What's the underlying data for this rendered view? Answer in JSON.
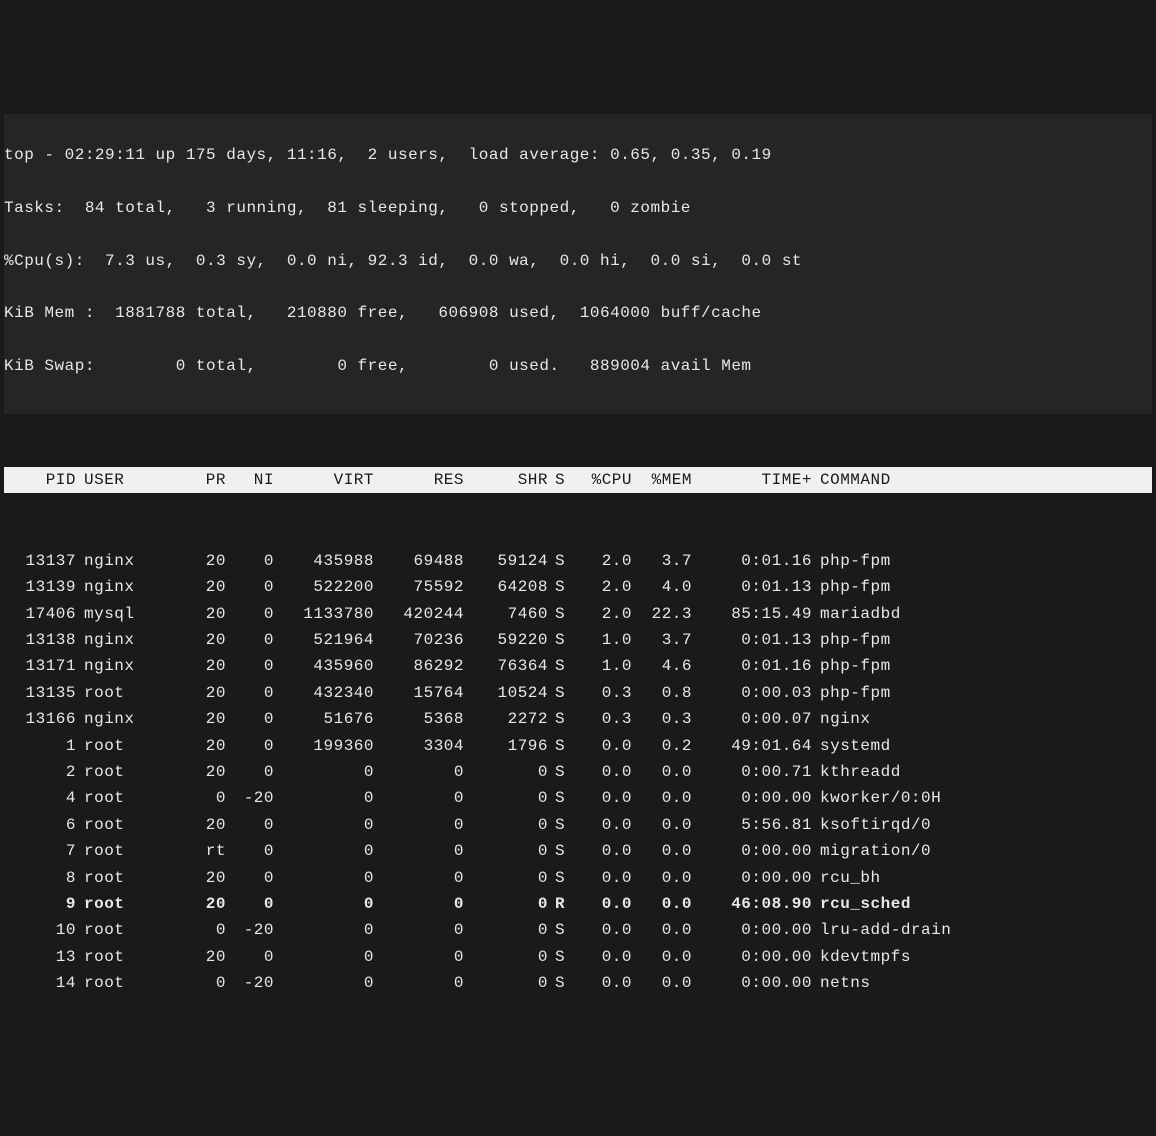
{
  "summary": {
    "line1": "top - 02:29:11 up 175 days, 11:16,  2 users,  load average: 0.65, 0.35, 0.19",
    "line2": "Tasks:  84 total,   3 running,  81 sleeping,   0 stopped,   0 zombie",
    "line3": "%Cpu(s):  7.3 us,  0.3 sy,  0.0 ni, 92.3 id,  0.0 wa,  0.0 hi,  0.0 si,  0.0 st",
    "line4": "KiB Mem :  1881788 total,   210880 free,   606908 used,  1064000 buff/cache",
    "line5": "KiB Swap:        0 total,        0 free,        0 used.   889004 avail Mem"
  },
  "columns": {
    "pid": "PID",
    "user": "USER",
    "pr": "PR",
    "ni": "NI",
    "virt": "VIRT",
    "res": "RES",
    "shr": "SHR",
    "s": "S",
    "cpu": "%CPU",
    "mem": "%MEM",
    "time": "TIME+",
    "cmd": "COMMAND"
  },
  "processes": [
    {
      "pid": "13137",
      "user": "nginx",
      "pr": "20",
      "ni": "0",
      "virt": "435988",
      "res": "69488",
      "shr": "59124",
      "s": "S",
      "cpu": "2.0",
      "mem": "3.7",
      "time": "0:01.16",
      "cmd": "php-fpm",
      "bold": false
    },
    {
      "pid": "13139",
      "user": "nginx",
      "pr": "20",
      "ni": "0",
      "virt": "522200",
      "res": "75592",
      "shr": "64208",
      "s": "S",
      "cpu": "2.0",
      "mem": "4.0",
      "time": "0:01.13",
      "cmd": "php-fpm",
      "bold": false
    },
    {
      "pid": "17406",
      "user": "mysql",
      "pr": "20",
      "ni": "0",
      "virt": "1133780",
      "res": "420244",
      "shr": "7460",
      "s": "S",
      "cpu": "2.0",
      "mem": "22.3",
      "time": "85:15.49",
      "cmd": "mariadbd",
      "bold": false
    },
    {
      "pid": "13138",
      "user": "nginx",
      "pr": "20",
      "ni": "0",
      "virt": "521964",
      "res": "70236",
      "shr": "59220",
      "s": "S",
      "cpu": "1.0",
      "mem": "3.7",
      "time": "0:01.13",
      "cmd": "php-fpm",
      "bold": false
    },
    {
      "pid": "13171",
      "user": "nginx",
      "pr": "20",
      "ni": "0",
      "virt": "435960",
      "res": "86292",
      "shr": "76364",
      "s": "S",
      "cpu": "1.0",
      "mem": "4.6",
      "time": "0:01.16",
      "cmd": "php-fpm",
      "bold": false
    },
    {
      "pid": "13135",
      "user": "root",
      "pr": "20",
      "ni": "0",
      "virt": "432340",
      "res": "15764",
      "shr": "10524",
      "s": "S",
      "cpu": "0.3",
      "mem": "0.8",
      "time": "0:00.03",
      "cmd": "php-fpm",
      "bold": false
    },
    {
      "pid": "13166",
      "user": "nginx",
      "pr": "20",
      "ni": "0",
      "virt": "51676",
      "res": "5368",
      "shr": "2272",
      "s": "S",
      "cpu": "0.3",
      "mem": "0.3",
      "time": "0:00.07",
      "cmd": "nginx",
      "bold": false
    },
    {
      "pid": "1",
      "user": "root",
      "pr": "20",
      "ni": "0",
      "virt": "199360",
      "res": "3304",
      "shr": "1796",
      "s": "S",
      "cpu": "0.0",
      "mem": "0.2",
      "time": "49:01.64",
      "cmd": "systemd",
      "bold": false
    },
    {
      "pid": "2",
      "user": "root",
      "pr": "20",
      "ni": "0",
      "virt": "0",
      "res": "0",
      "shr": "0",
      "s": "S",
      "cpu": "0.0",
      "mem": "0.0",
      "time": "0:00.71",
      "cmd": "kthreadd",
      "bold": false
    },
    {
      "pid": "4",
      "user": "root",
      "pr": "0",
      "ni": "-20",
      "virt": "0",
      "res": "0",
      "shr": "0",
      "s": "S",
      "cpu": "0.0",
      "mem": "0.0",
      "time": "0:00.00",
      "cmd": "kworker/0:0H",
      "bold": false
    },
    {
      "pid": "6",
      "user": "root",
      "pr": "20",
      "ni": "0",
      "virt": "0",
      "res": "0",
      "shr": "0",
      "s": "S",
      "cpu": "0.0",
      "mem": "0.0",
      "time": "5:56.81",
      "cmd": "ksoftirqd/0",
      "bold": false
    },
    {
      "pid": "7",
      "user": "root",
      "pr": "rt",
      "ni": "0",
      "virt": "0",
      "res": "0",
      "shr": "0",
      "s": "S",
      "cpu": "0.0",
      "mem": "0.0",
      "time": "0:00.00",
      "cmd": "migration/0",
      "bold": false
    },
    {
      "pid": "8",
      "user": "root",
      "pr": "20",
      "ni": "0",
      "virt": "0",
      "res": "0",
      "shr": "0",
      "s": "S",
      "cpu": "0.0",
      "mem": "0.0",
      "time": "0:00.00",
      "cmd": "rcu_bh",
      "bold": false
    },
    {
      "pid": "9",
      "user": "root",
      "pr": "20",
      "ni": "0",
      "virt": "0",
      "res": "0",
      "shr": "0",
      "s": "R",
      "cpu": "0.0",
      "mem": "0.0",
      "time": "46:08.90",
      "cmd": "rcu_sched",
      "bold": true
    },
    {
      "pid": "10",
      "user": "root",
      "pr": "0",
      "ni": "-20",
      "virt": "0",
      "res": "0",
      "shr": "0",
      "s": "S",
      "cpu": "0.0",
      "mem": "0.0",
      "time": "0:00.00",
      "cmd": "lru-add-drain",
      "bold": false
    },
    {
      "pid": "13",
      "user": "root",
      "pr": "20",
      "ni": "0",
      "virt": "0",
      "res": "0",
      "shr": "0",
      "s": "S",
      "cpu": "0.0",
      "mem": "0.0",
      "time": "0:00.00",
      "cmd": "kdevtmpfs",
      "bold": false
    },
    {
      "pid": "14",
      "user": "root",
      "pr": "0",
      "ni": "-20",
      "virt": "0",
      "res": "0",
      "shr": "0",
      "s": "S",
      "cpu": "0.0",
      "mem": "0.0",
      "time": "0:00.00",
      "cmd": "netns",
      "bold": false
    }
  ]
}
